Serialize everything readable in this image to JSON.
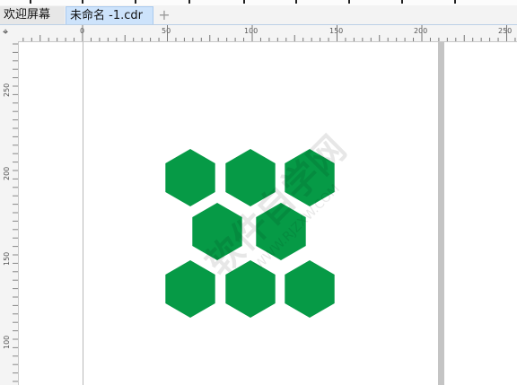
{
  "tabs": [
    {
      "label": "欢迎屏幕"
    },
    {
      "label": "未命名 -1.cdr"
    }
  ],
  "add_tab_symbol": "+",
  "ruler_corner_icon": "cursor-origin-icon",
  "ruler": {
    "h_labels": [
      "0",
      "50",
      "100",
      "150",
      "200",
      "250"
    ],
    "v_labels": [
      "250",
      "200",
      "150",
      "100"
    ]
  },
  "shape_color": "#069a46",
  "watermark": {
    "text": "软件自学网",
    "url": "WWW.RJZXW.COM"
  }
}
